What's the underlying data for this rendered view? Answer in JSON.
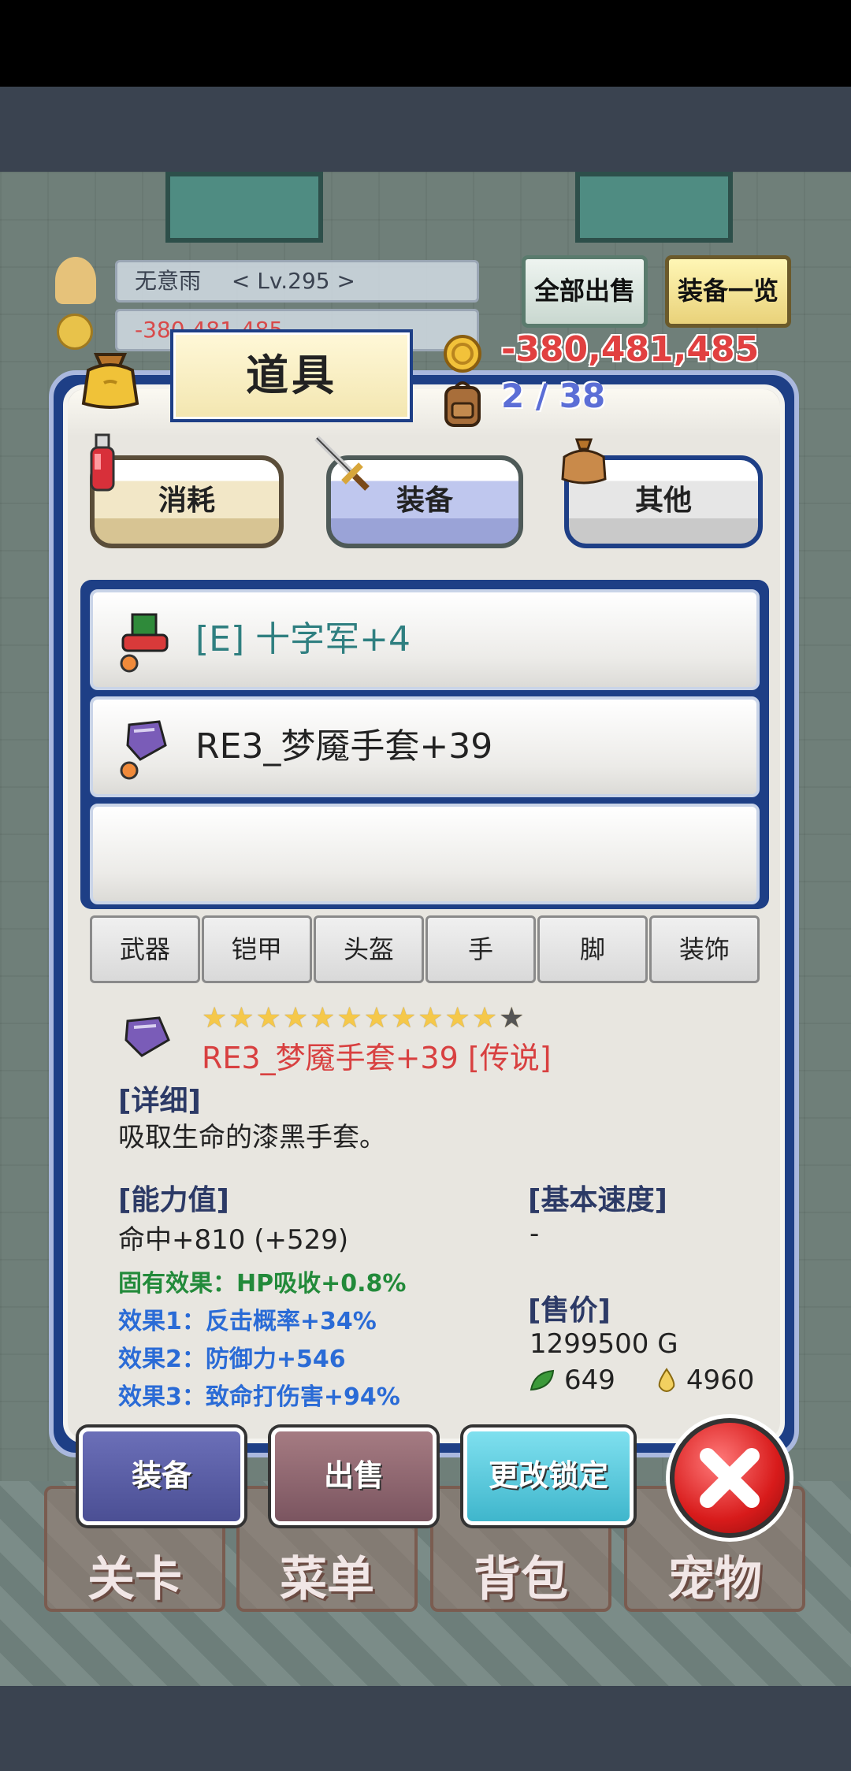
{
  "background_hud": {
    "player_name": "无意雨",
    "player_level": "< Lv.295 >",
    "gold_background": "-380,481,485",
    "sell_all_button": "全部出售",
    "equipment_list_button": "装备一览",
    "bottom_nav": [
      "关卡",
      "菜单",
      "背包",
      "宠物"
    ]
  },
  "panel": {
    "title": "道具",
    "gold": "-380,481,485",
    "inventory_count": "2 / 38",
    "category_tabs": [
      {
        "label": "消耗",
        "selected": false
      },
      {
        "label": "装备",
        "selected": true
      },
      {
        "label": "其他",
        "selected": false
      }
    ],
    "items": [
      {
        "name": "[E] 十字军+4",
        "color": "#2f7f80"
      },
      {
        "name": "RE3_梦魇手套+39",
        "color": "#222222"
      },
      {
        "name": "",
        "color": "#222222"
      }
    ],
    "filter_tabs": [
      "武器",
      "铠甲",
      "头盔",
      "手",
      "脚",
      "装饰"
    ]
  },
  "detail": {
    "stars_filled": 11,
    "stars_total": 12,
    "item_name": "RE3_梦魇手套+39 [传说]",
    "detail_label": "[详细]",
    "description": "吸取生命的漆黑手套。",
    "stats_label": "[能力值]",
    "stat_main": "命中+810 (+529)",
    "inherent_effect": "固有效果：HP吸收+0.8%",
    "effects": [
      "效果1：反击概率+34%",
      "效果2：防御力+546",
      "效果3：致命打伤害+94%"
    ],
    "speed_label": "[基本速度]",
    "speed_value": "-",
    "price_label": "[售价]",
    "price_value": "1299500 G",
    "material_leaf": "649",
    "material_drop": "4960"
  },
  "actions": {
    "equip": "装备",
    "sell": "出售",
    "change_lock": "更改锁定"
  },
  "colors": {
    "panel_frame": "#1e3f86",
    "gold_text": "#e14040",
    "legend_text": "#d84040",
    "inherent_green": "#228a3a",
    "effect_blue": "#2a6bd6"
  }
}
